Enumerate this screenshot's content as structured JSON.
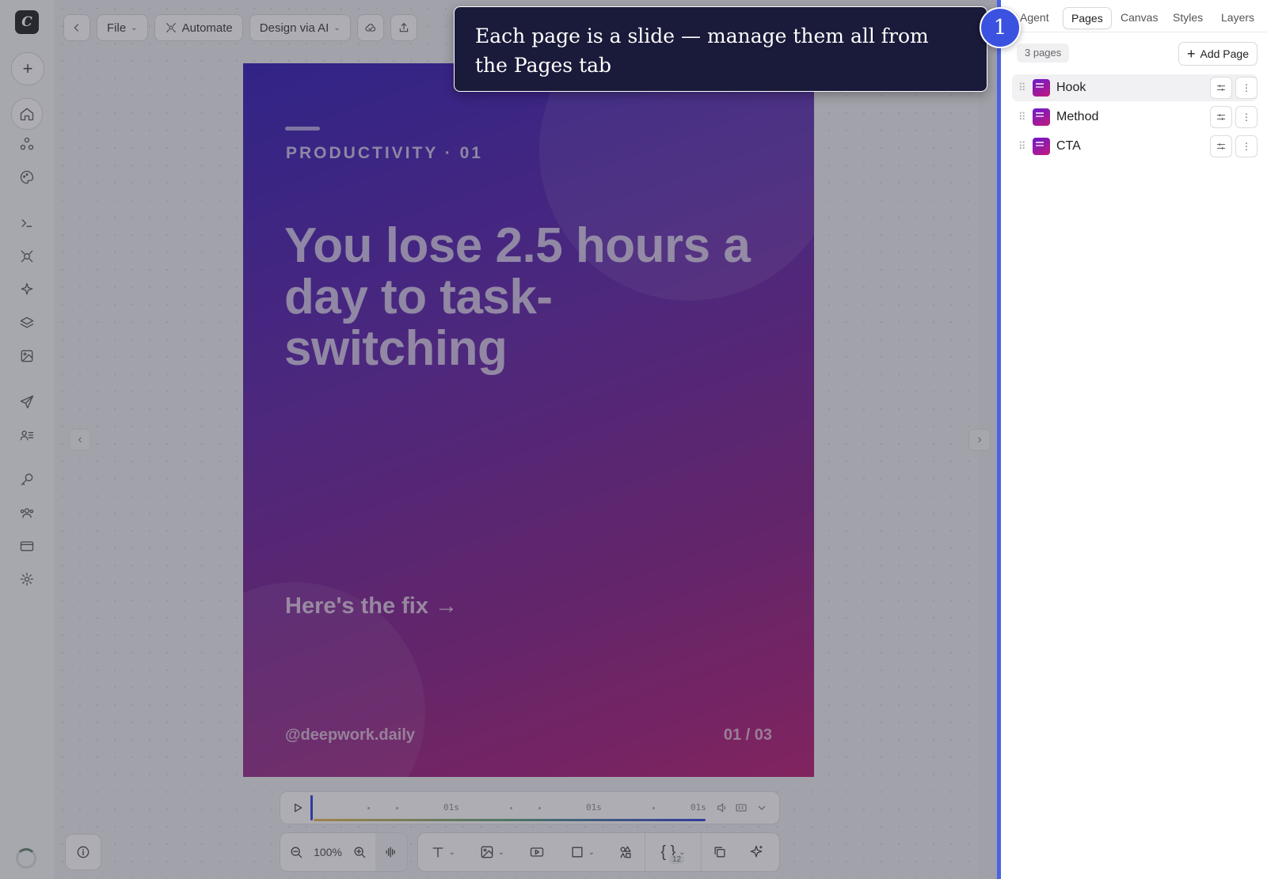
{
  "topbar": {
    "back_label": "<",
    "file_label": "File",
    "automate_label": "Automate",
    "design_ai_label": "Design via AI"
  },
  "slide": {
    "eyebrow": "PRODUCTIVITY · 01",
    "headline": "You lose 2.5 hours a day to task-switching",
    "cta": "Here's the fix →",
    "handle": "@deepwork.daily",
    "pager": "01 / 03"
  },
  "timeline": {
    "labels": [
      "01s",
      "01s",
      "01s"
    ]
  },
  "toolbar": {
    "zoom": "100%",
    "variables_count": "12"
  },
  "panel": {
    "tabs": [
      "Agent",
      "Pages",
      "Canvas",
      "Styles",
      "Layers"
    ],
    "active_tab": "Pages",
    "page_count": "3 pages",
    "add_page_label": "Add Page",
    "pages": [
      {
        "name": "Hook",
        "active": true
      },
      {
        "name": "Method",
        "active": false
      },
      {
        "name": "CTA",
        "active": false
      }
    ]
  },
  "tour": {
    "step": "1",
    "message": "Each page is a slide — manage them all from the Pages tab"
  },
  "colors": {
    "accent": "#3b52e0",
    "slide_gradient_start": "#2a14b3",
    "slide_gradient_end": "#b3136e",
    "tooltip_bg": "#1a1a3a"
  }
}
